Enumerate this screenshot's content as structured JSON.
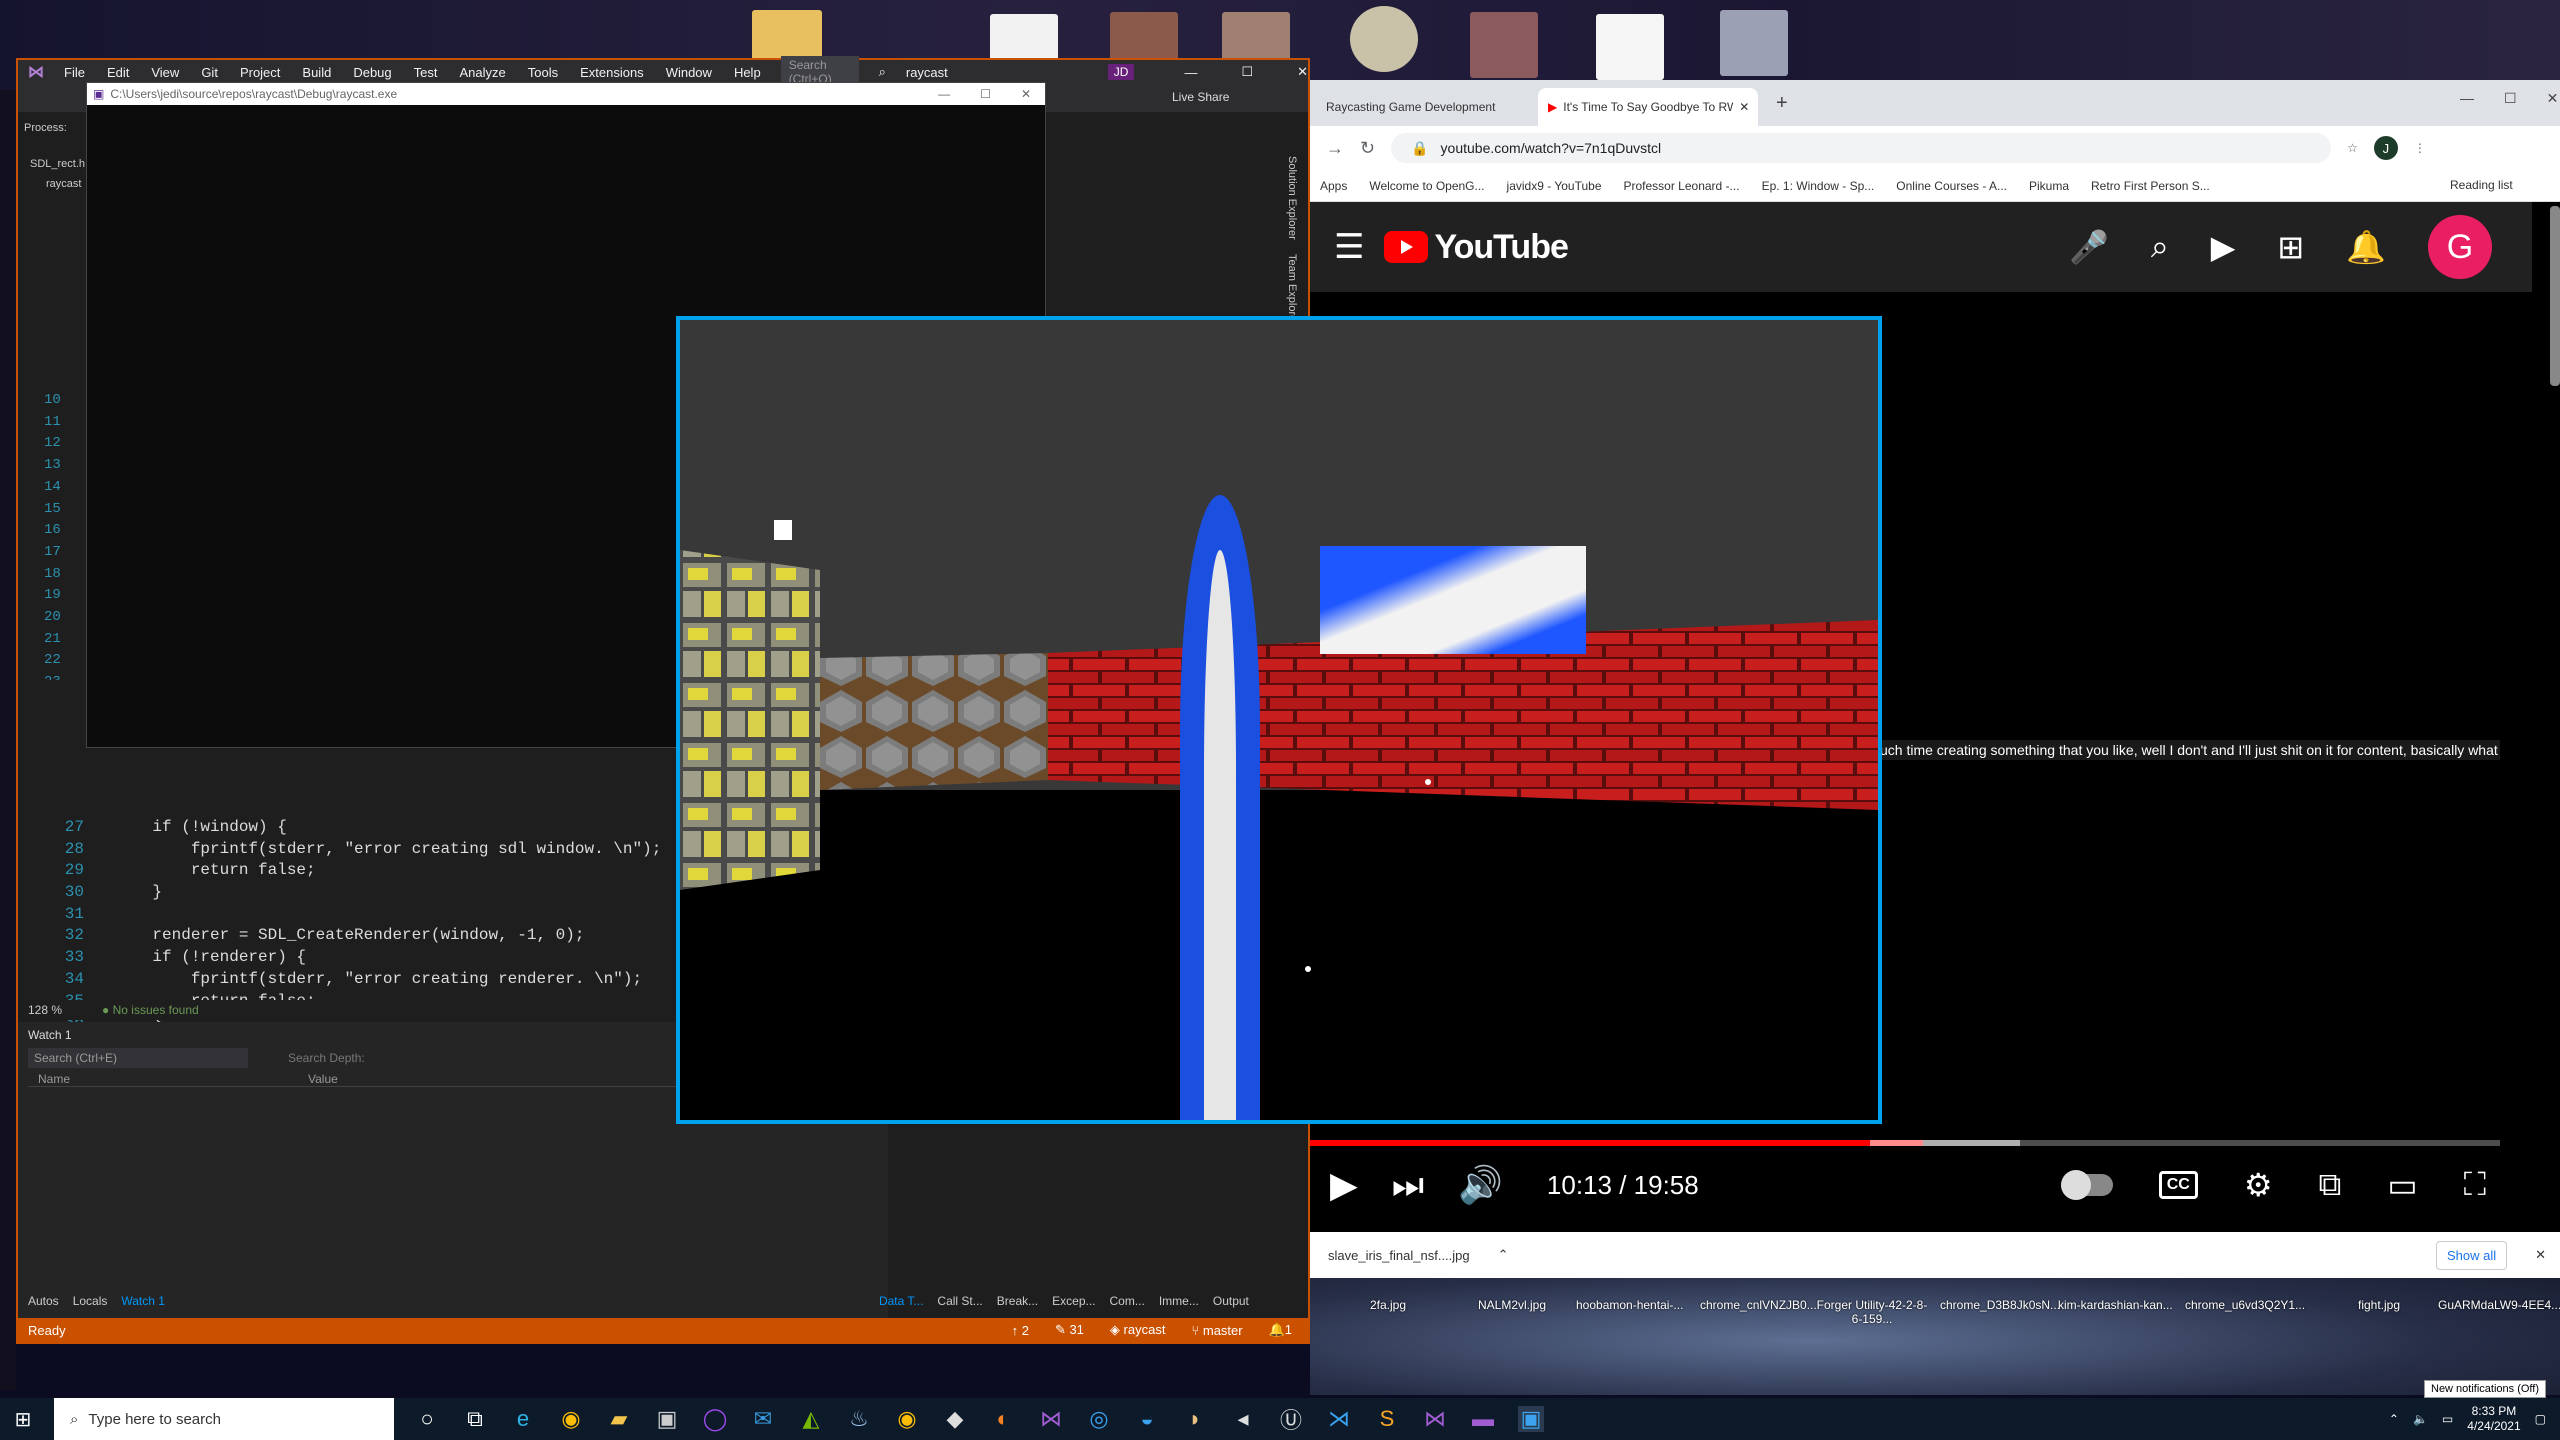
{
  "desktop": {
    "bottom_icons": [
      {
        "label": "fight.jpg"
      },
      {
        "label": "GuARMdaLW9-4EE4...."
      },
      {
        "label": "chrome_u6vd3Q2Y1..."
      },
      {
        "label": "kim-kardashian-kan..."
      },
      {
        "label": "chrome_D3B8Jk0sN..."
      },
      {
        "label": "Forger Utility-42-2-8-6-159..."
      },
      {
        "label": "chrome_cnlVNZJB0..."
      },
      {
        "label": "hoobamon-hentai-..."
      },
      {
        "label": "NALM2vl.jpg"
      },
      {
        "label": "2fa.jpg"
      }
    ]
  },
  "vs": {
    "menu": [
      "File",
      "Edit",
      "View",
      "Git",
      "Project",
      "Build",
      "Debug",
      "Test",
      "Analyze",
      "Tools",
      "Extensions",
      "Window",
      "Help"
    ],
    "search_placeholder": "Search (Ctrl+Q)",
    "solution_name": "raycast",
    "user_badge": "JD",
    "live_share": "Live Share",
    "process_label": "Process:",
    "file_tab": "SDL_rect.h",
    "project_item": "raycast",
    "side_tabs": [
      "Solution Explorer",
      "Team Explorer"
    ],
    "code": [
      {
        "n": "27",
        "text": "    if (!window) {"
      },
      {
        "n": "28",
        "text": "        fprintf(stderr, \"error creating sdl window. \\n\");"
      },
      {
        "n": "29",
        "text": "        return false;"
      },
      {
        "n": "30",
        "text": "    }"
      },
      {
        "n": "31",
        "text": ""
      },
      {
        "n": "32",
        "text": "    renderer = SDL_CreateRenderer(window, -1, 0);"
      },
      {
        "n": "33",
        "text": "    if (!renderer) {"
      },
      {
        "n": "34",
        "text": "        fprintf(stderr, \"error creating renderer. \\n\");"
      },
      {
        "n": "35",
        "text": "        return false;"
      },
      {
        "n": "36",
        "text": "    }"
      },
      {
        "n": "37",
        "text": ""
      }
    ],
    "hidden_line_numbers": [
      "10",
      "11",
      "12",
      "13",
      "14",
      "15",
      "16",
      "17",
      "18",
      "19",
      "20",
      "21",
      "22",
      "23",
      "24",
      "25",
      "26"
    ],
    "zoom": "128 %",
    "issues": "No issues found",
    "watch_title": "Watch 1",
    "watch_search": "Search (Ctrl+E)",
    "search_depth": "Search Depth:",
    "col_name": "Name",
    "col_value": "Value",
    "bottom_tabs_left": [
      "Autos",
      "Locals",
      "Watch 1"
    ],
    "bottom_tabs_right": [
      "Data T...",
      "Call St...",
      "Break...",
      "Excep...",
      "Com...",
      "Imme...",
      "Output"
    ],
    "status": {
      "ready": "Ready",
      "up": "2",
      "edits": "31",
      "repo": "raycast",
      "branch": "master",
      "bell": "1"
    }
  },
  "console": {
    "path": "C:\\Users\\jedi\\source\\repos\\raycast\\Debug\\raycast.exe"
  },
  "chrome": {
    "tabs": [
      {
        "title": "Raycasting Game Development"
      },
      {
        "title": "It's Time To Say Goodbye To RWBY"
      }
    ],
    "url": "youtube.com/watch?v=7n1qDuvstcl",
    "bookmarks": [
      "Apps",
      "Welcome to OpenG...",
      "javidx9 - YouTube",
      "Professor Leonard -...",
      "Ep. 1: Window - Sp...",
      "Online Courses - A...",
      "Pikuma",
      "Retro First Person S..."
    ],
    "reading_list": "Reading list",
    "profile": "J",
    "youtube": {
      "logo": "YouTube",
      "avatar": "G",
      "caption": "uch time creating something that you like, well I don't and I'll just shit on it for content, basically what",
      "progress_fraction": 0.515,
      "time": "10:13 / 19:58",
      "cc": "CC"
    },
    "download_file": "slave_iris_final_nsf....jpg",
    "show_all": "Show all"
  },
  "taskbar": {
    "search_placeholder": "Type here to search",
    "time": "8:33 PM",
    "date": "4/24/2021",
    "notification": "New notifications (Off)"
  },
  "colors": {
    "vs_accent": "#ca5100",
    "game_border": "#00a2ed",
    "yt_red": "#ff0000"
  }
}
